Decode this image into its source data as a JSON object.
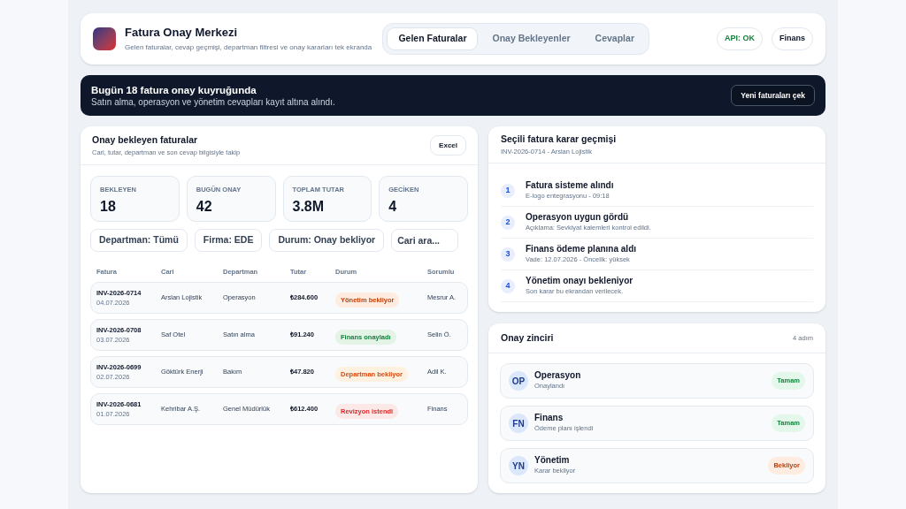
{
  "header": {
    "title": "Fatura Onay Merkezi",
    "subtitle": "Gelen faturalar, cevap geçmişi, departman filtresi ve onay kararları tek ekranda",
    "tabs": [
      {
        "label": "Gelen Faturalar",
        "selected": true
      },
      {
        "label": "Onay Bekleyenler",
        "selected": false
      },
      {
        "label": "Cevaplar",
        "selected": false
      }
    ],
    "api_status": "API: OK",
    "department": "Finans"
  },
  "banner": {
    "title": "Bugün 18 fatura onay kuyruğunda",
    "subtitle": "Satın alma, operasyon ve yönetim cevapları kayıt altına alındı.",
    "button": "Yeni faturaları çek"
  },
  "invoices_panel": {
    "title": "Onay bekleyen faturalar",
    "subtitle": "Cari, tutar, departman ve son cevap bilgisiyle takip",
    "export_button": "Excel",
    "stats": [
      {
        "label": "BEKLEYEN",
        "value": "18"
      },
      {
        "label": "BUGÜN ONAY",
        "value": "42"
      },
      {
        "label": "TOPLAM TUTAR",
        "value": "3.8M"
      },
      {
        "label": "GECİKEN",
        "value": "4"
      }
    ],
    "filters": [
      {
        "kind": "select",
        "value": "Departman: Tümü"
      },
      {
        "kind": "select",
        "value": "Firma: EDE"
      },
      {
        "kind": "select",
        "value": "Durum: Onay bekliyor"
      },
      {
        "kind": "search",
        "placeholder": "Cari ara..."
      }
    ],
    "table": {
      "columns": [
        "Fatura",
        "Cari",
        "Departman",
        "Tutar",
        "Durum",
        "Sorumlu"
      ],
      "rows": [
        {
          "invoice": "INV-2026-0714",
          "date": "04.07.2026",
          "account": "Arslan Lojistik",
          "department": "Operasyon",
          "amount": "₺284.600",
          "status": {
            "label": "Yönetim bekliyor",
            "kind": "waiting"
          },
          "owner": "Mesrur A."
        },
        {
          "invoice": "INV-2026-0708",
          "date": "03.07.2026",
          "account": "Saf Otel",
          "department": "Satın alma",
          "amount": "₺91.240",
          "status": {
            "label": "Finans onayladı",
            "kind": "approved"
          },
          "owner": "Selin Ö."
        },
        {
          "invoice": "INV-2026-0699",
          "date": "02.07.2026",
          "account": "Göktürk Enerji",
          "department": "Bakım",
          "amount": "₺47.820",
          "status": {
            "label": "Departman bekliyor",
            "kind": "pending"
          },
          "owner": "Adil K."
        },
        {
          "invoice": "INV-2026-0681",
          "date": "01.07.2026",
          "account": "Kehribar A.Ş.",
          "department": "Genel Müdürlük",
          "amount": "₺612.400",
          "status": {
            "label": "Revizyon istendi",
            "kind": "revision"
          },
          "owner": "Finans"
        }
      ]
    }
  },
  "history_panel": {
    "title": "Seçili fatura karar geçmişi",
    "subtitle": "INV-2026-0714 - Arslan Lojistik",
    "steps": [
      {
        "number": "1",
        "title": "Fatura sisteme alındı",
        "detail": "E-logo entegrasyonu - 09:18"
      },
      {
        "number": "2",
        "title": "Operasyon uygun gördü",
        "detail": "Açıklama: Sevkiyat kalemleri kontrol edildi."
      },
      {
        "number": "3",
        "title": "Finans ödeme planına aldı",
        "detail": "Vade: 12.07.2026 - Öncelik: yüksek"
      },
      {
        "number": "4",
        "title": "Yönetim onayı bekleniyor",
        "detail": "Son karar bu ekrandan verilecek."
      }
    ]
  },
  "chain_panel": {
    "title": "Onay zinciri",
    "count": "4 adım",
    "steps": [
      {
        "initials": "OP",
        "name": "Operasyon",
        "detail": "Onaylandı",
        "status": {
          "label": "Tamam",
          "kind": "done"
        }
      },
      {
        "initials": "FN",
        "name": "Finans",
        "detail": "Ödeme planı işlendi",
        "status": {
          "label": "Tamam",
          "kind": "done"
        }
      },
      {
        "initials": "YN",
        "name": "Yönetim",
        "detail": "Karar bekliyor",
        "status": {
          "label": "Bekliyor",
          "kind": "waiting"
        }
      }
    ]
  }
}
